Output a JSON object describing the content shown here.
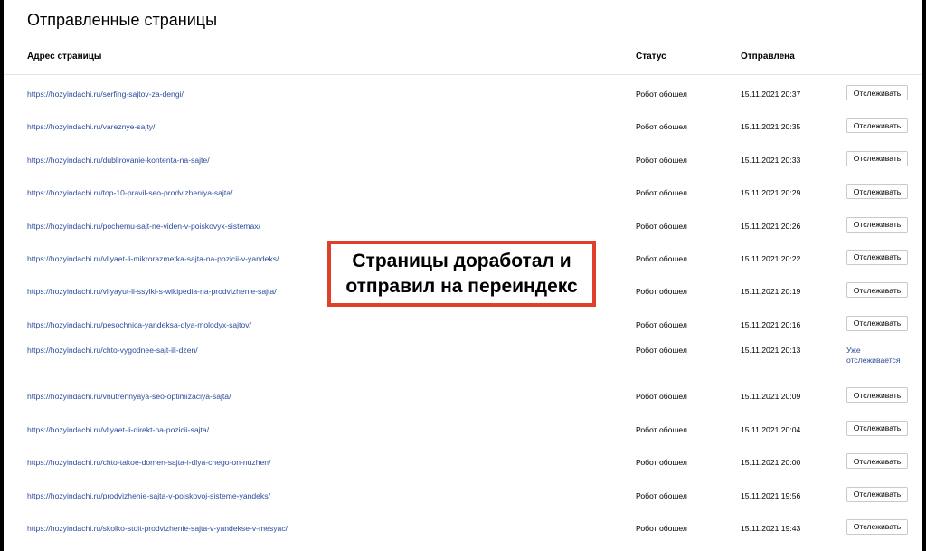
{
  "page": {
    "title": "Отправленные страницы"
  },
  "table": {
    "columns": {
      "url": "Адрес страницы",
      "status": "Статус",
      "sent": "Отправлена"
    },
    "rows": [
      {
        "url": "https://hozyindachi.ru/serfing-sajtov-za-dengi/",
        "status": "Робот обошел",
        "date": "15.11.2021 20:37",
        "action": "Отслеживать"
      },
      {
        "url": "https://hozyindachi.ru/vareznye-sajty/",
        "status": "Робот обошел",
        "date": "15.11.2021 20:35",
        "action": "Отслеживать"
      },
      {
        "url": "https://hozyindachi.ru/dublirovanie-kontenta-na-sajte/",
        "status": "Робот обошел",
        "date": "15.11.2021 20:33",
        "action": "Отслеживать"
      },
      {
        "url": "https://hozyindachi.ru/top-10-pravil-seo-prodvizheniya-sajta/",
        "status": "Робот обошел",
        "date": "15.11.2021 20:29",
        "action": "Отслеживать"
      },
      {
        "url": "https://hozyindachi.ru/pochemu-sajt-ne-viden-v-poiskovyx-sistemax/",
        "status": "Робот обошел",
        "date": "15.11.2021 20:26",
        "action": "Отслеживать"
      },
      {
        "url": "https://hozyindachi.ru/vliyaet-li-mikrorazmetka-sajta-na-pozicii-v-yandeks/",
        "status": "Робот обошел",
        "date": "15.11.2021 20:22",
        "action": "Отслеживать"
      },
      {
        "url": "https://hozyindachi.ru/vliyayut-li-ssylki-s-wikipedia-na-prodvizhenie-sajta/",
        "status": "Робот обошел",
        "date": "15.11.2021 20:19",
        "action": "Отслеживать"
      },
      {
        "url": "https://hozyindachi.ru/pesochnica-yandeksa-dlya-molodyx-sajtov/",
        "status": "Робот обошел",
        "date": "15.11.2021 20:16",
        "action": "Отслеживать"
      },
      {
        "url": "https://hozyindachi.ru/chto-vygodnee-sajt-ili-dzen/",
        "status": "Робот обошел",
        "date": "15.11.2021 20:13",
        "tracked_line1": "Уже",
        "tracked_line2": "отслеживается"
      },
      {
        "url": "https://hozyindachi.ru/vnutrennyaya-seo-optimizaciya-sajta/",
        "status": "Робот обошел",
        "date": "15.11.2021 20:09",
        "action": "Отслеживать"
      },
      {
        "url": "https://hozyindachi.ru/vliyaet-li-direkt-na-pozicii-sajta/",
        "status": "Робот обошел",
        "date": "15.11.2021 20:04",
        "action": "Отслеживать"
      },
      {
        "url": "https://hozyindachi.ru/chto-takoe-domen-sajta-i-dlya-chego-on-nuzhen/",
        "status": "Робот обошел",
        "date": "15.11.2021 20:00",
        "action": "Отслеживать"
      },
      {
        "url": "https://hozyindachi.ru/prodvizhenie-sajta-v-poiskovoj-sisteme-yandeks/",
        "status": "Робот обошел",
        "date": "15.11.2021 19:56",
        "action": "Отслеживать"
      },
      {
        "url": "https://hozyindachi.ru/skolko-stoit-prodvizhenie-sajta-v-yandekse-v-mesyac/",
        "status": "Робот обошел",
        "date": "15.11.2021 19:43",
        "action": "Отслеживать"
      }
    ]
  },
  "callout": {
    "line1": "Страницы доработал и",
    "line2": "отправил на переиндекс",
    "border_color": "#e0402a"
  },
  "colors": {
    "link": "#2b4c9c",
    "background": "#ffffff",
    "frame": "#000000"
  }
}
